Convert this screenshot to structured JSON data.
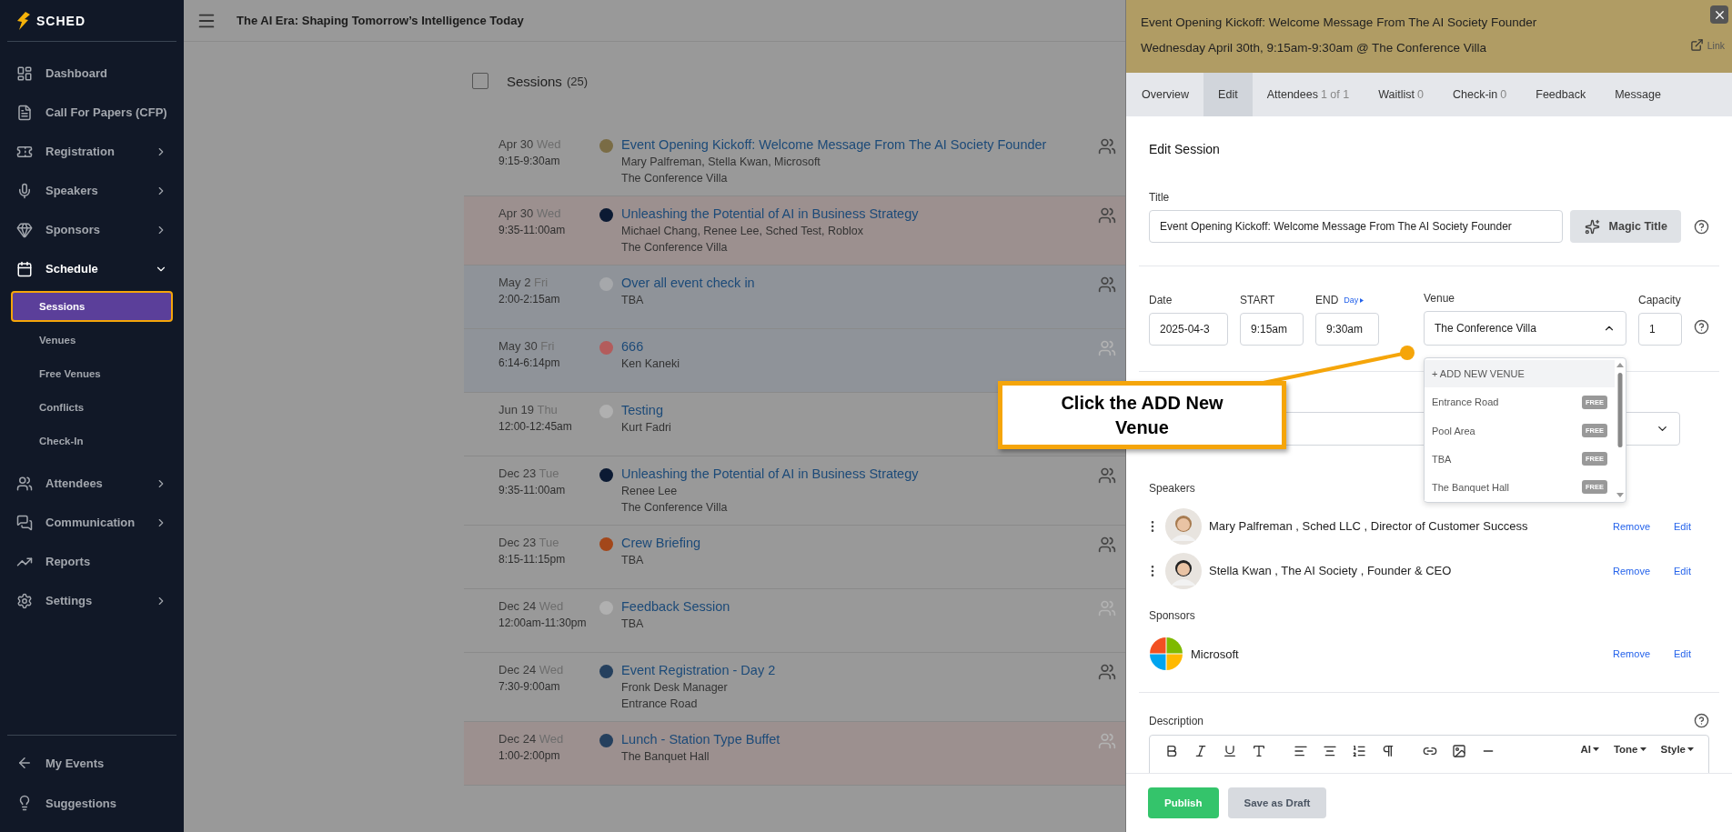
{
  "sidebar": {
    "logo": "SCHED",
    "items": [
      {
        "label": "Dashboard",
        "expandable": false,
        "expanded": false
      },
      {
        "label": "Call For Papers (CFP)",
        "expandable": false,
        "expanded": false
      },
      {
        "label": "Registration",
        "expandable": true,
        "expanded": false
      },
      {
        "label": "Speakers",
        "expandable": true,
        "expanded": false
      },
      {
        "label": "Sponsors",
        "expandable": true,
        "expanded": false
      },
      {
        "label": "Schedule",
        "expandable": true,
        "expanded": true,
        "children": [
          {
            "label": "Sessions",
            "selected": true
          },
          {
            "label": "Venues",
            "selected": false
          },
          {
            "label": "Free Venues",
            "selected": false
          },
          {
            "label": "Conflicts",
            "selected": false
          },
          {
            "label": "Check-In",
            "selected": false
          }
        ]
      },
      {
        "label": "Attendees",
        "expandable": true,
        "expanded": false
      },
      {
        "label": "Communication",
        "expandable": true,
        "expanded": false
      },
      {
        "label": "Reports",
        "expandable": false,
        "expanded": false
      },
      {
        "label": "Settings",
        "expandable": true,
        "expanded": false
      }
    ],
    "footer_items": [
      {
        "label": "My Events"
      },
      {
        "label": "Suggestions"
      }
    ]
  },
  "header": {
    "title": "The AI Era: Shaping Tomorrow’s Intelligence Today"
  },
  "sessions": {
    "title": "Sessions",
    "count": "(25)",
    "checked": false,
    "rows": [
      {
        "date": "Apr 30",
        "weekday": "Wed",
        "time": "9:15-9:30am",
        "color": "#7a6c45",
        "title": "Event Opening Kickoff: Welcome Message From The AI Society Founder",
        "lines": [
          "Mary Palfreman, Stella Kwan, Microsoft",
          "The Conference Villa"
        ],
        "kind": "plain",
        "icon_dim": false
      },
      {
        "date": "Apr 30",
        "weekday": "Wed",
        "time": "9:35-11:00am",
        "color": "#0b1a33",
        "title": "Unleashing the Potential of AI in Business Strategy",
        "lines": [
          "Michael Chang, Renee Lee, Sched Test, Roblox",
          "The Conference Villa"
        ],
        "kind": "warm",
        "icon_dim": false
      },
      {
        "date": "May 2",
        "weekday": "Fri",
        "time": "2:00-2:15am",
        "color": "#a6a8ab",
        "title": "Over all event check in",
        "lines": [
          "TBA"
        ],
        "kind": "cool",
        "icon_dim": false
      },
      {
        "date": "May 30",
        "weekday": "Fri",
        "time": "6:14-6:14pm",
        "color": "#b35c5c",
        "title": "666",
        "lines": [
          "Ken Kaneki"
        ],
        "kind": "cool",
        "icon_dim": true
      },
      {
        "date": "Jun 19",
        "weekday": "Thu",
        "time": "12:00-12:45am",
        "color": "#b0b0b0",
        "title": "Testing",
        "lines": [
          "Kurt Fadri"
        ],
        "kind": "plain"
      },
      {
        "date": "Dec 23",
        "weekday": "Tue",
        "time": "9:35-11:00am",
        "color": "#0b1a33",
        "title": "Unleashing the Potential of AI in Business Strategy",
        "lines": [
          "Renee Lee",
          "The Conference Villa"
        ],
        "kind": "plain",
        "icon_dim": false
      },
      {
        "date": "Dec 23",
        "weekday": "Tue",
        "time": "8:15-11:15pm",
        "color": "#a3471a",
        "title": "Crew Briefing",
        "lines": [
          "TBA"
        ],
        "kind": "plain",
        "icon_dim": false
      },
      {
        "date": "Dec 24",
        "weekday": "Wed",
        "time": "12:00am-11:30pm",
        "color": "#b0b0b0",
        "title": "Feedback Session",
        "lines": [
          "TBA"
        ],
        "kind": "plain",
        "icon_dim": true
      },
      {
        "date": "Dec 24",
        "weekday": "Wed",
        "time": "7:30-9:00am",
        "color": "#25405e",
        "title": "Event Registration - Day 2",
        "lines": [
          "Fronk Desk Manager",
          "Entrance Road"
        ],
        "kind": "plain",
        "icon_dim": false
      },
      {
        "date": "Dec 24",
        "weekday": "Wed",
        "time": "1:00-2:00pm",
        "color": "#25405e",
        "title": "Lunch - Station Type Buffet",
        "lines": [
          "The Banquet Hall"
        ],
        "kind": "warm",
        "icon_dim": true
      }
    ]
  },
  "panel": {
    "title": "Event Opening Kickoff: Welcome Message From The AI Society Founder",
    "subtitle": "Wednesday April 30th, 9:15am-9:30am @ The Conference Villa",
    "link": "Link",
    "tabs": [
      {
        "label": "Overview",
        "selected": false
      },
      {
        "label": "Edit",
        "selected": true
      },
      {
        "label": "Attendees",
        "count": "1 of 1",
        "selected": false
      },
      {
        "label": "Waitlist",
        "count": "0",
        "selected": false
      },
      {
        "label": "Check-in",
        "count": "0",
        "selected": false
      },
      {
        "label": "Feedback",
        "selected": false
      },
      {
        "label": "Message",
        "selected": false
      }
    ],
    "heading": "Edit Session",
    "title_label": "Title",
    "title_value": "Event Opening Kickoff: Welcome Message From The AI Society Founder",
    "magic_button": "Magic Title",
    "date_label": "Date",
    "date_value": "2025-04-3",
    "start_label": "START",
    "start_value": "9:15am",
    "end_label": "END",
    "end_link": "Day",
    "end_value": "9:30am",
    "venue_label": "Venue",
    "venue_value": "The Conference Villa",
    "venue_open": true,
    "venue_options": [
      {
        "label": "+ ADD NEW VENUE",
        "selected": true
      },
      {
        "label": "Entrance Road",
        "badge": "FREE",
        "selected": false
      },
      {
        "label": "Pool Area",
        "badge": "FREE",
        "selected": false
      },
      {
        "label": "TBA",
        "badge": "FREE",
        "selected": false
      },
      {
        "label": "The Banquet Hall",
        "badge": "FREE",
        "selected": false
      }
    ],
    "capacity_label": "Capacity",
    "capacity_value": "1",
    "speakers_label": "Speakers",
    "speakers": [
      {
        "text": "Mary Palfreman , Sched LLC , Director of Customer Success",
        "actions": [
          "Remove",
          "Edit"
        ]
      },
      {
        "text": "Stella Kwan , The AI Society , Founder & CEO",
        "actions": [
          "Remove",
          "Edit"
        ]
      }
    ],
    "sponsors_label": "Sponsors",
    "sponsors": [
      {
        "text": "Microsoft",
        "actions": [
          "Remove",
          "Edit"
        ]
      }
    ],
    "description_label": "Description",
    "editor_menus": [
      "AI",
      "Tone",
      "Style"
    ],
    "buttons": [
      {
        "label": "Publish",
        "kind": "primary"
      },
      {
        "label": "Save as Draft",
        "kind": "secondary"
      }
    ]
  },
  "callout": {
    "text": "Click the ADD New Venue"
  }
}
